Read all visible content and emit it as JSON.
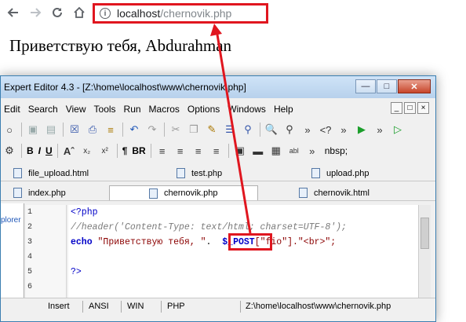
{
  "browser": {
    "url_host": "localhost",
    "url_path": "/chernovik.php"
  },
  "page": {
    "greeting": "Приветствую тебя, Abdurahman"
  },
  "editor": {
    "title": "Expert Editor 4.3 - [Z:\\home\\localhost\\www\\chernovik.php]",
    "menu": [
      "Edit",
      "Search",
      "View",
      "Tools",
      "Run",
      "Macros",
      "Options",
      "Windows",
      "Help"
    ],
    "toolbar2_text": {
      "bold": "B",
      "italic": "I",
      "underline": "U",
      "para": "¶",
      "br": "BR",
      "nbsp": "nbsp;"
    },
    "tabs_row1": [
      "file_upload.html",
      "test.php",
      "upload.php"
    ],
    "tabs_row2": [
      "index.php",
      "chernovik.php",
      "chernovik.html"
    ],
    "explorer_label": "plorer",
    "line_numbers": [
      "1",
      "2",
      "3",
      "4",
      "5",
      "6"
    ],
    "code": {
      "line1": "<?php",
      "line2": "//header('Content-Type: text/html; charset=UTF-8');",
      "line3_kw": "echo",
      "line3_str": "\"Приветствую тебя, \"",
      "line3_dot1": ".",
      "line3_var": "$_POST",
      "line3_rest": "[\"fio\"].\"<br>\";",
      "line5": "?>"
    },
    "status": {
      "mode": "Insert",
      "encoding": "ANSI",
      "eol": "WIN",
      "syntax": "PHP",
      "path": "Z:\\home\\localhost\\www\\chernovik.php"
    }
  },
  "colors": {
    "annotation_red": "#e0161f",
    "keyword_blue": "#0000c8",
    "string_dark_red": "#8b0000"
  }
}
